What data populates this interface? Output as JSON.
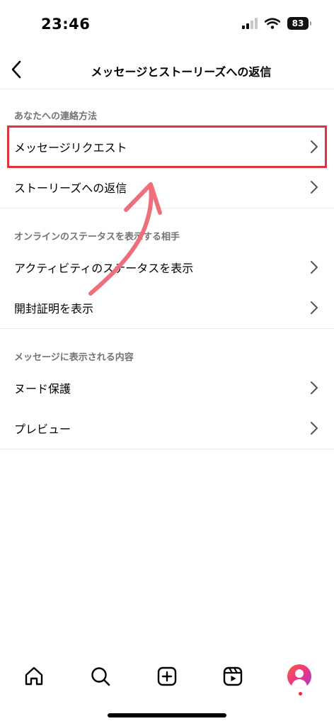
{
  "status_bar": {
    "time": "23:46",
    "battery_level": "83"
  },
  "header": {
    "title": "メッセージとストーリーズへの返信"
  },
  "sections": [
    {
      "label": "あなたへの連絡方法",
      "items": [
        {
          "label": "メッセージリクエスト"
        },
        {
          "label": "ストーリーズへの返信"
        }
      ]
    },
    {
      "label": "オンラインのステータスを表示する相手",
      "items": [
        {
          "label": "アクティビティのステータスを表示"
        },
        {
          "label": "開封証明を表示"
        }
      ]
    },
    {
      "label": "メッセージに表示される内容",
      "items": [
        {
          "label": "ヌード保護"
        },
        {
          "label": "プレビュー"
        }
      ]
    }
  ],
  "annotation": {
    "highlight_color": "#e0323f",
    "arrow_color": "#ee6f7a"
  },
  "tab_bar": {
    "icons": [
      "home-icon",
      "search-icon",
      "create-icon",
      "reels-icon",
      "profile-avatar"
    ]
  }
}
